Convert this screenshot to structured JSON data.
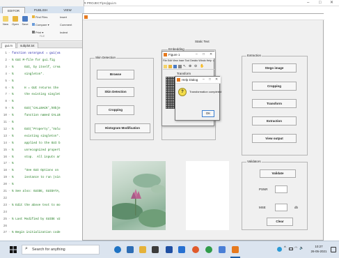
{
  "editor": {
    "title_bar": "Editor - C:\\Users\\DIMPANAMPA\\Desktop\\project\\MAJOR PROJECT\\proj\\gui.m",
    "ribbon_tabs": [
      "EDITOR",
      "PUBLISH",
      "VIEW"
    ],
    "ribbon_buttons": {
      "new": "New",
      "open": "Open",
      "save": "Save",
      "find_files": "Find Files",
      "compare": "Compare ▾",
      "print": "Print ▾",
      "insert": "Insert",
      "comment": "Comment",
      "indent": "Indent"
    },
    "ribbon_section": "FILE",
    "file_tabs": [
      "gui.m",
      "subplot.txt"
    ],
    "code_lines": [
      {
        "n": "1",
        "t": "function varargout = gui(va",
        "kw": true
      },
      {
        "n": "2",
        "t": "% GUI M-file for gui.fig"
      },
      {
        "n": "3",
        "t": "%      GUI, by itself, crea"
      },
      {
        "n": "4",
        "t": "%      singleton*."
      },
      {
        "n": "5",
        "t": "%"
      },
      {
        "n": "6",
        "t": "%      H = GUI returns the"
      },
      {
        "n": "7",
        "t": "%      the existing singlet"
      },
      {
        "n": "8",
        "t": "%"
      },
      {
        "n": "9",
        "t": "%      GUI('CALLBACK',hObje"
      },
      {
        "n": "10",
        "t": "%      function named CALLB"
      },
      {
        "n": "11",
        "t": "%"
      },
      {
        "n": "12",
        "t": "%      GUI('Property','Valu"
      },
      {
        "n": "13",
        "t": "%      existing singleton*."
      },
      {
        "n": "14",
        "t": "%      applied to the GUI b"
      },
      {
        "n": "15",
        "t": "%      unrecognized propert"
      },
      {
        "n": "16",
        "t": "%      stop.  All inputs ar"
      },
      {
        "n": "17",
        "t": "%"
      },
      {
        "n": "18",
        "t": "%      *See GUI Options on"
      },
      {
        "n": "19",
        "t": "%      instance to run (sin"
      },
      {
        "n": "20",
        "t": "%"
      },
      {
        "n": "21",
        "t": "% See also: GUIDE, GUIDATA,"
      },
      {
        "n": "22",
        "t": ""
      },
      {
        "n": "23",
        "t": "% Edit the above text to mo"
      },
      {
        "n": "24",
        "t": ""
      },
      {
        "n": "25",
        "t": "% Last Modified by GUIDE v2"
      },
      {
        "n": "26",
        "t": ""
      },
      {
        "n": "27",
        "t": "% Begin initialization code"
      }
    ]
  },
  "gui": {
    "static_text": "Static Text",
    "skin_detection": {
      "title": "Skin Detection",
      "buttons": [
        "Browse",
        "Skin Detection",
        "Cropping",
        "Histogram Modification"
      ]
    },
    "embedding": {
      "title": "Embedding"
    },
    "extraction": {
      "title": "Extraction",
      "buttons": [
        "Stego image",
        "Cropping",
        "Transform",
        "Extraction",
        "View output"
      ]
    },
    "validators": {
      "title": "Validators",
      "validate": "Validate",
      "psnr_label": "PSNR",
      "mse_label": "MSE",
      "db_unit": "db",
      "clear": "Clear"
    }
  },
  "figure1": {
    "title": "Figure 1",
    "menu": "File  Edit  View  Inser  Tool  Deskto  Windo  Help  ↘",
    "axes_title": "Transform"
  },
  "help_dialog": {
    "title": "Help Dialog",
    "message": "Transformation completed",
    "ok": "OK"
  },
  "taskbar": {
    "search": "Search for anything",
    "time": "10:27",
    "date": "26-05-2021"
  },
  "colors": {
    "accent": "#1f5fa8",
    "code_comment": "#1a7a1a",
    "code_keyword": "#1c1ca8"
  }
}
